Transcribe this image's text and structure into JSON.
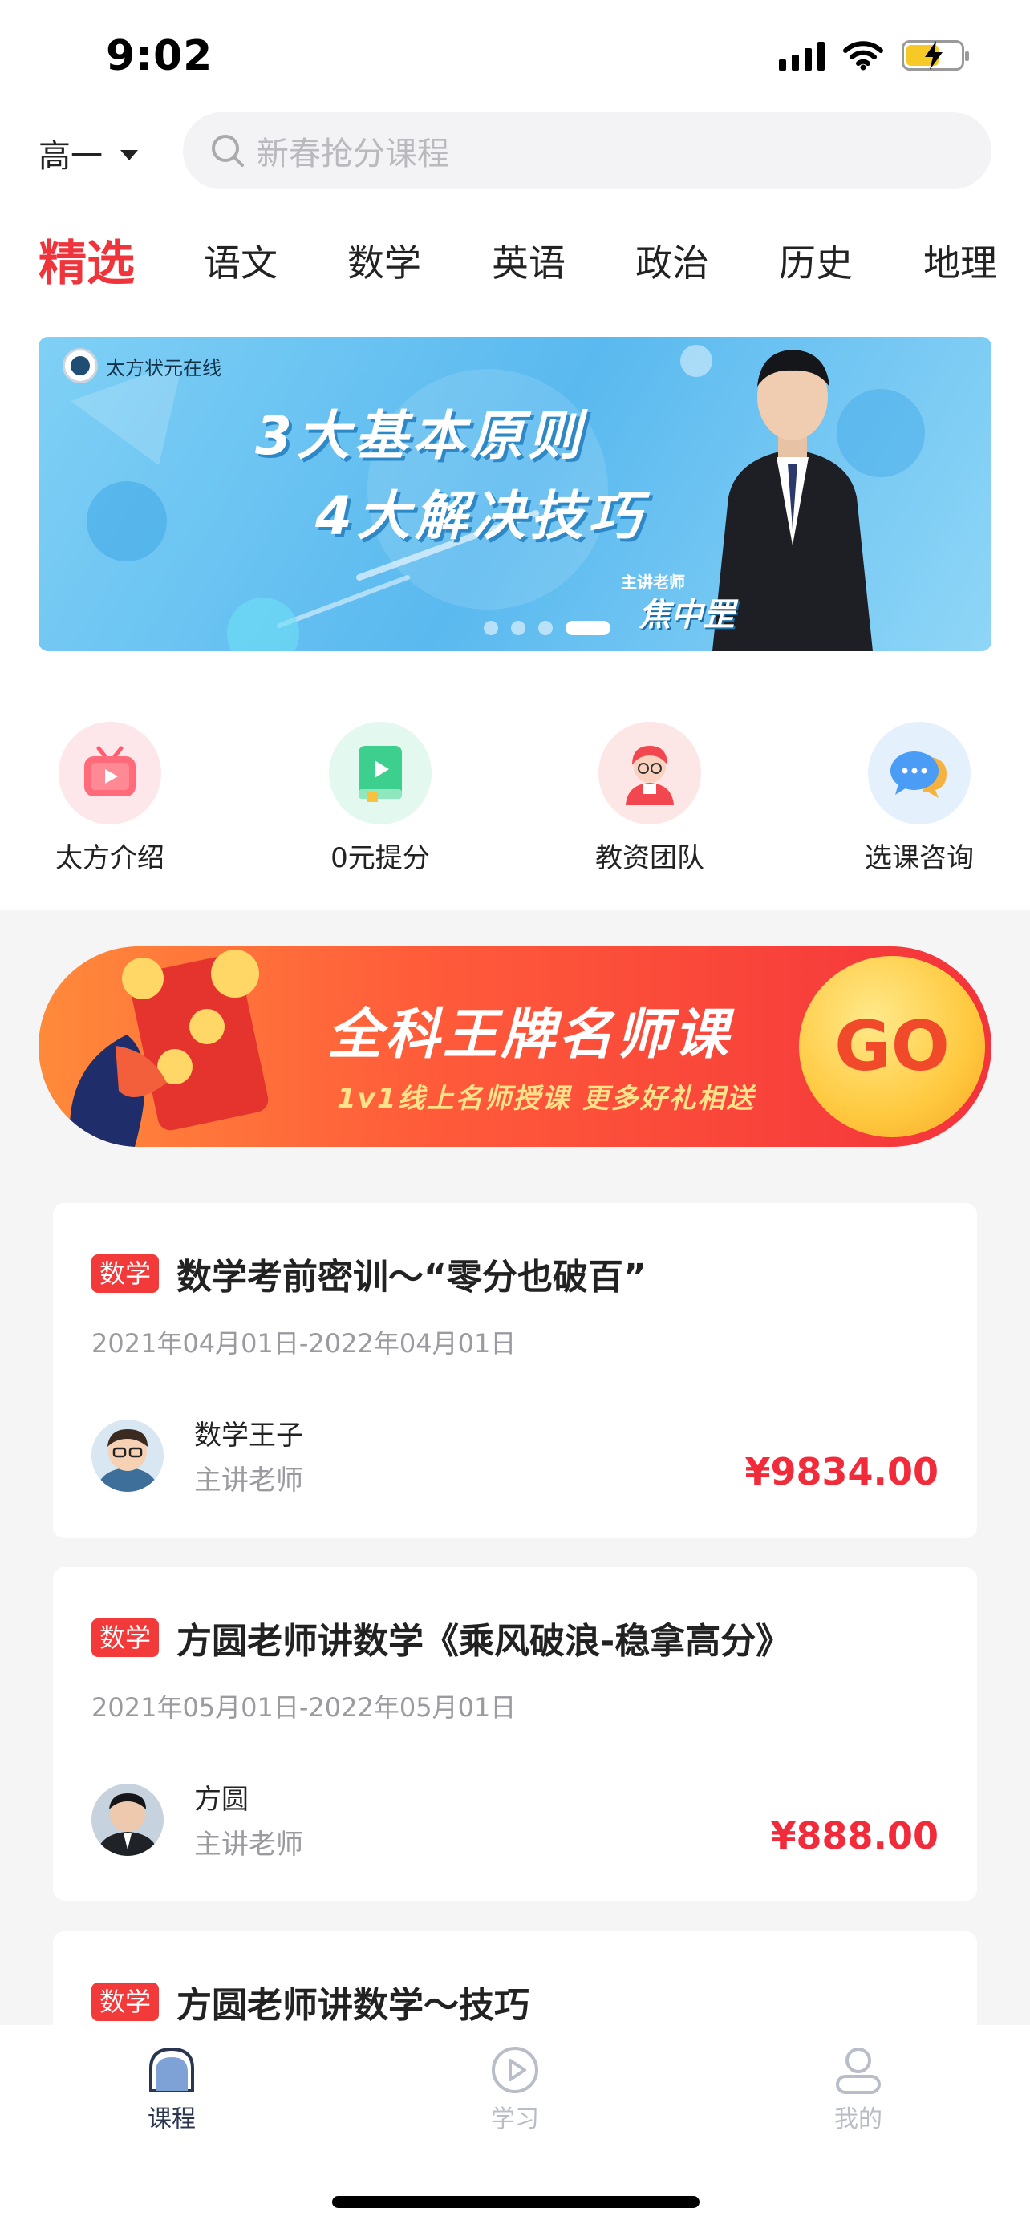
{
  "status_bar": {
    "time": "9:02"
  },
  "header": {
    "grade": "高一",
    "search_placeholder": "新春抢分课程"
  },
  "tabs": [
    "精选",
    "语文",
    "数学",
    "英语",
    "政治",
    "历史",
    "地理"
  ],
  "active_tab": "精选",
  "banner": {
    "logo_text": "太方状元在线",
    "line1": "3大基本原则",
    "line2": "4大解决技巧",
    "teacher_tag": "主讲老师",
    "teacher_name": "焦中罡",
    "slide_count": 4,
    "active_slide": 4
  },
  "quick_entries": [
    {
      "label": "太方介绍",
      "icon": "tv-play-icon",
      "color": "#ff6b7b"
    },
    {
      "label": "0元提分",
      "icon": "book-play-icon",
      "color": "#3ccf8e"
    },
    {
      "label": "教资团队",
      "icon": "teacher-avatar-icon",
      "color": "#f2474f"
    },
    {
      "label": "选课咨询",
      "icon": "chat-bubble-icon",
      "color": "#4a9cf5"
    }
  ],
  "promo": {
    "title": "全科王牌名师课",
    "subtitle": "1v1线上名师授课  更多好礼相送",
    "button": "GO"
  },
  "courses": [
    {
      "subject": "数学",
      "title": "数学考前密训～“零分也破百”",
      "date": "2021年04月01日-2022年04月01日",
      "teacher": "数学王子",
      "role": "主讲老师",
      "price": "¥9834.00"
    },
    {
      "subject": "数学",
      "title": "方圆老师讲数学《乘风破浪-稳拿高分》",
      "date": "2021年05月01日-2022年05月01日",
      "teacher": "方圆",
      "role": "主讲老师",
      "price": "¥888.00"
    },
    {
      "subject": "数学",
      "title": "方圆老师讲数学～技巧"
    }
  ],
  "bottom_nav": [
    {
      "label": "课程",
      "icon": "home-icon",
      "active": true
    },
    {
      "label": "学习",
      "icon": "play-circle-icon",
      "active": false
    },
    {
      "label": "我的",
      "icon": "user-icon",
      "active": false
    }
  ],
  "colors": {
    "accent": "#f0343c",
    "price": "#f12b3a",
    "nav_active": "#2a3550",
    "nav_inactive": "#b8bdc8"
  }
}
